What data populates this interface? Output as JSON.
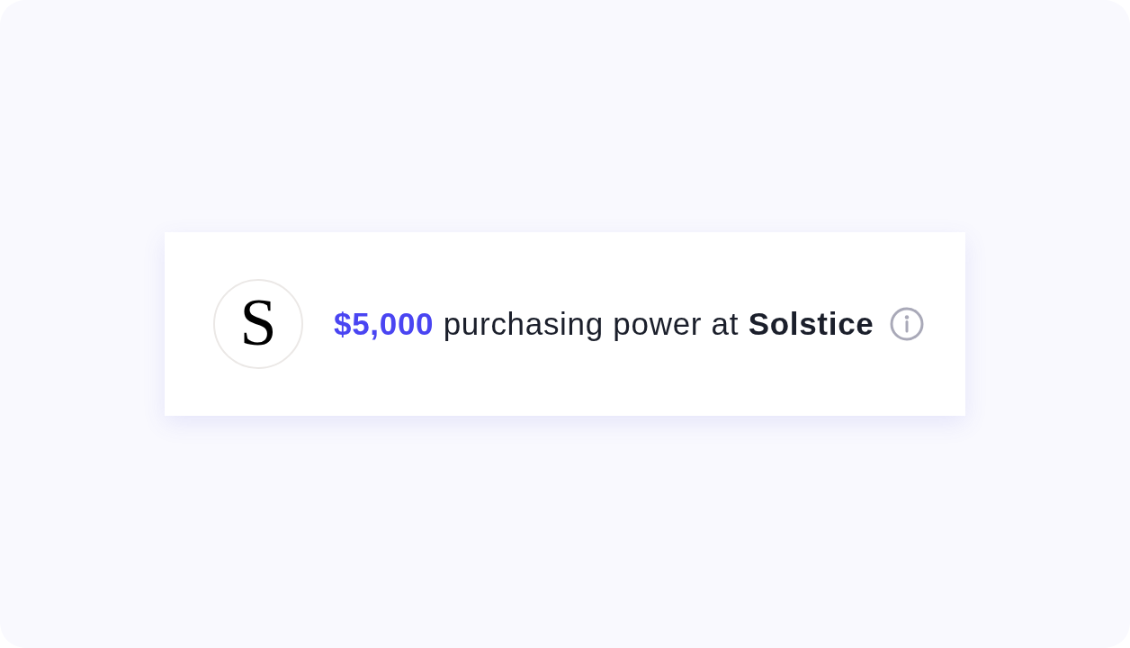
{
  "offer_card": {
    "logo": {
      "letter": "S"
    },
    "amount": "$5,000",
    "text": "purchasing power at",
    "merchant": "Solstice"
  }
}
